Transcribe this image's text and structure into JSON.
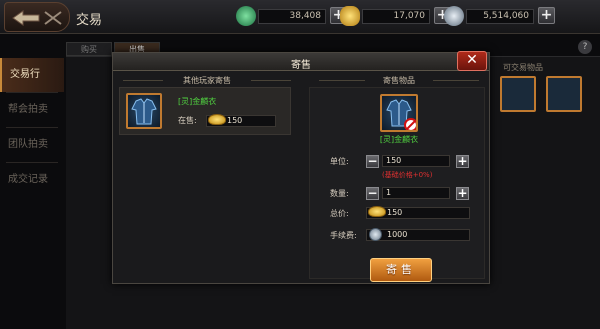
{
  "topbar": {
    "title": "交易",
    "currencies": [
      {
        "icon": "jade-currency-icon",
        "value": "38,408",
        "color": "#3aa860"
      },
      {
        "icon": "gold-ingot-icon",
        "value": "17,070",
        "color": "#e0b030"
      },
      {
        "icon": "silver-coin-icon",
        "value": "5,514,060",
        "color": "#9aa8b8"
      }
    ]
  },
  "leftmenu": {
    "items": [
      "交易行",
      "帮会拍卖",
      "团队拍卖",
      "成交记录"
    ]
  },
  "background": {
    "tabs": [
      "购买",
      "出售"
    ],
    "right_label": "可交易物品"
  },
  "modal": {
    "title": "寄售",
    "left_section": "其他玩家寄售",
    "right_section": "寄售物品",
    "listing": {
      "item_name": "[灵]金麟衣",
      "onsale_label": "在售:",
      "price": "150"
    },
    "sell_item": {
      "item_name": "[灵]金麟衣"
    },
    "unit_price": {
      "label": "单位:",
      "value": "150",
      "ref": "(基础价格+0%)"
    },
    "quantity": {
      "label": "数量:",
      "value": "1"
    },
    "total": {
      "label": "总价:",
      "value": "150"
    },
    "fee": {
      "label": "手续费:",
      "value": "1000"
    },
    "sell_button": "寄售"
  }
}
